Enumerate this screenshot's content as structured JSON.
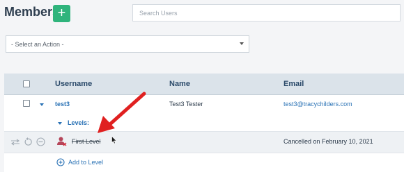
{
  "header": {
    "title": "Members",
    "add_symbol": "+",
    "search_placeholder": "Search Users"
  },
  "actions": {
    "select_placeholder": "- Select an Action -"
  },
  "table": {
    "columns": {
      "username": "Username",
      "name": "Name",
      "email": "Email"
    },
    "member": {
      "username": "test3",
      "name": "Test3 Tester",
      "email": "test3@tracychilders.com",
      "levels_label": "Levels:"
    },
    "level": {
      "name": "First Level",
      "status": "Cancelled on February 10, 2021"
    },
    "add_level_label": "Add to Level"
  },
  "colors": {
    "accent_green": "#2fb47c",
    "link_blue": "#2a72b5",
    "header_row": "#dbe3ea",
    "annotation_red": "#e02020",
    "cancelled_icon": "#b5465a"
  }
}
